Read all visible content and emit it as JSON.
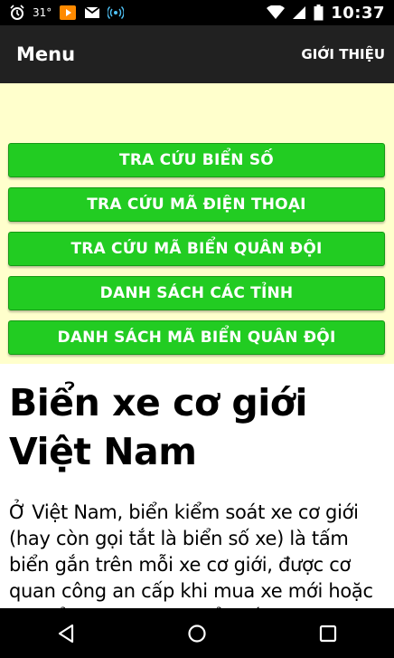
{
  "status_bar": {
    "temperature": "31°",
    "time": "10:37",
    "icons": [
      "alarm-icon",
      "media-icon",
      "gmail-icon",
      "network-icon",
      "wifi-icon",
      "signal-icon",
      "battery-icon"
    ]
  },
  "app_bar": {
    "title": "Menu",
    "action_label": "GIỚI THIỆU"
  },
  "buttons": [
    "TRA CỨU BIỂN SỐ",
    "TRA CỨU MÃ ĐIỆN THOẠI",
    "TRA CỨU MÃ BIỂN QUÂN ĐỘI",
    "DANH SÁCH CÁC TỈNH",
    "DANH SÁCH MÃ BIỂN QUÂN ĐỘI"
  ],
  "article": {
    "title": "Biển xe cơ giới Việt Nam",
    "body": "Ở Việt Nam, biển kiểm soát xe cơ giới (hay còn gọi tắt là biển số xe) là tấm biển gắn trên mỗi xe cơ giới, được cơ quan công an cấp khi mua xe mới hoặc chuyển nhượng xe. Biển số xe"
  },
  "colors": {
    "button_green": "#22cc22",
    "panel_yellow": "#ffffcc",
    "app_bar": "#212121"
  },
  "nav": {
    "icons": [
      "back-icon",
      "home-icon",
      "recents-icon"
    ]
  }
}
